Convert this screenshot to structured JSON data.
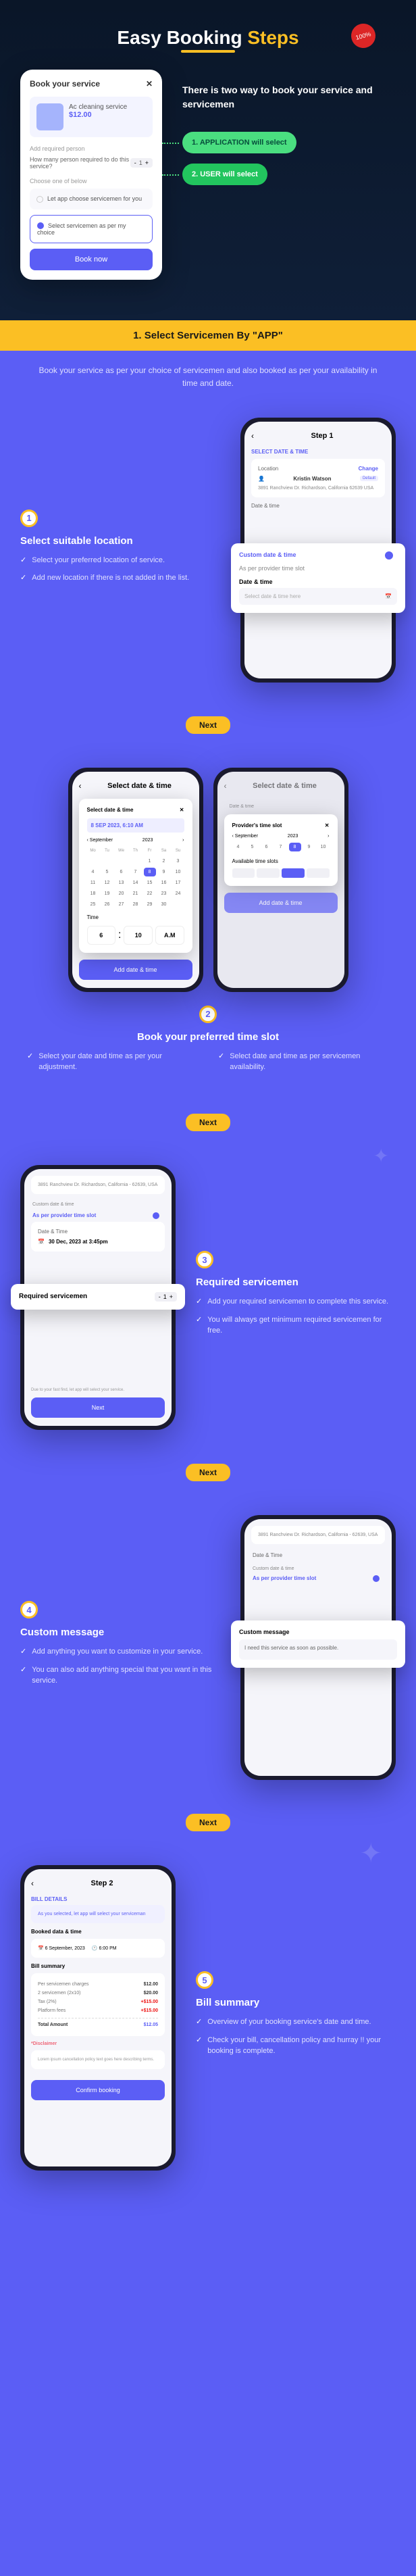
{
  "header": {
    "title_prefix": "Easy Booking",
    "title_suffix": "Steps",
    "badge": "100%"
  },
  "hero": {
    "phone": {
      "title": "Book your service",
      "service": "Ac cleaning service",
      "price": "$12.00",
      "add_person_label": "Add required person",
      "person_question": "How many person required to do this service?",
      "count": "1",
      "choose_label": "Choose one of below",
      "opt1": "Let app choose servicemen for you",
      "opt2": "Select servicemen as per my choice",
      "button": "Book now"
    },
    "text": "There is two way to book your service and servicemen",
    "pill1": "1. APPLICATION will select",
    "pill2": "2. USER will select"
  },
  "banner": "1. Select Servicemen By \"APP\"",
  "banner_sub": "Book your service as per your choice of servicemen and also booked as per your availability in time and date.",
  "next": "Next",
  "step1": {
    "num": "1",
    "title": "Select suitable location",
    "items": [
      "Select your preferred location of service.",
      "Add new location if there is not added in the list."
    ],
    "phone": {
      "title": "Step 1",
      "select_date": "SELECT DATE & TIME",
      "location_label": "Location",
      "change": "Change",
      "name": "Kristin Watson",
      "default": "Default",
      "address": "3891 Ranchview Dr. Richardson, California 62639 USA",
      "date_time": "Date & time",
      "custom": "Custom date & time",
      "provider": "As per provider time slot",
      "dt_label": "Date & time",
      "select_btn": "Select date & time here"
    }
  },
  "step2": {
    "num": "2",
    "title": "Book your preferred time slot",
    "left_phone": {
      "title": "Select date & time",
      "date_display": "8 SEP 2023, 6:10 AM",
      "month": "September",
      "year": "2023",
      "time_label": "Time",
      "hour": "6",
      "min": "10",
      "ampm": "A.M",
      "button": "Add date & time"
    },
    "right_phone": {
      "title": "Select date & time",
      "provider_slot": "Provider's time slot",
      "month": "September",
      "year": "2023",
      "available": "Available time slots",
      "button": "Add date & time"
    },
    "col1": "Select your date and time as per your adjustment.",
    "col2": "Select date and time as per servicemen availability."
  },
  "step3": {
    "num": "3",
    "title": "Required servicemen",
    "items": [
      "Add your required servicemen to complete this service.",
      "You will always get minimum required servicemen for free."
    ],
    "phone": {
      "address": "3891 Ranchview Dr. Richardson, California - 62639, USA",
      "custom": "Custom date & time",
      "provider": "As per provider time slot",
      "dt": "Date & Time",
      "dt_val": "30 Dec, 2023 at 3:45pm",
      "req_label": "Required servicemen",
      "req_count": "1",
      "note": "Due to your fast find, let app will select your service.",
      "next": "Next"
    }
  },
  "step4": {
    "num": "4",
    "title": "Custom message",
    "items": [
      "Add anything you want to customize in your service.",
      "You can also add anything special that you want in this service."
    ],
    "phone": {
      "address": "3891 Ranchview Dr. Richardson, California - 62639, USA",
      "dt": "Date & Time",
      "custom": "Custom date & time",
      "provider": "As per provider time slot",
      "msg_label": "Custom message",
      "msg_val": "I need this service as soon as possible."
    }
  },
  "step5": {
    "num": "5",
    "title": "Bill summary",
    "items": [
      "Overview of your booking service's date and time.",
      "Check your bill, cancellation policy and hurray !! your booking is complete."
    ],
    "phone": {
      "title": "Step 2",
      "bill_details": "BILL DETAILS",
      "auto_note": "As you selected, let app will select your serviceman",
      "booked_dt": "Booked data & time",
      "date": "6 September, 2023",
      "time": "6:00 PM",
      "summary": "Bill summary",
      "per_price": "Per servicemen charges",
      "per_price_v": "$12.00",
      "servicemen": "2 servicemen (2x10)",
      "servicemen_v": "$20.00",
      "tax": "Tax (2%)",
      "tax_v": "+$15.00",
      "fee": "Platform fees",
      "fee_v": "+$15.00",
      "total": "Total Amount",
      "total_v": "$12.05",
      "disclaimer": "*Disclaimer",
      "confirm": "Confirm booking"
    }
  }
}
